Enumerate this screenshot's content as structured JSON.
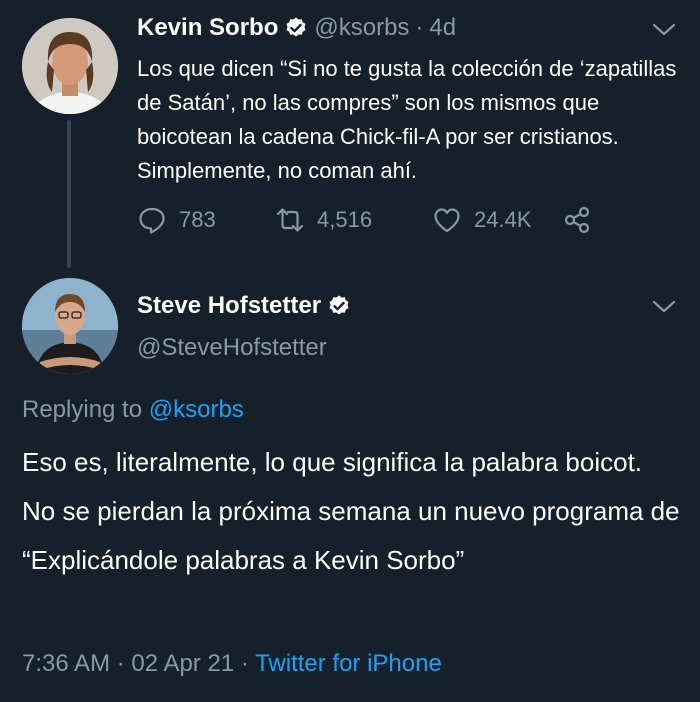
{
  "original_tweet": {
    "author_name": "Kevin Sorbo",
    "author_handle": "@ksorbs",
    "separator": "·",
    "time_ago": "4d",
    "text": "Los que dicen “Si no te gusta la colección de ‘zapatillas de Satán’, no las compres” son los mismos que boicotean la cadena Chick-fil-A por ser cristianos. Simplemente, no coman ahí.",
    "replies": "783",
    "retweets": "4,516",
    "likes": "24.4K"
  },
  "reply_tweet": {
    "author_name": "Steve Hofstetter",
    "author_handle": "@SteveHofstetter",
    "replying_prefix": "Replying to",
    "replying_to": "@ksorbs",
    "text_line1": "Eso es, literalmente, lo que significa la palabra boicot.",
    "text_line2": "No se pierdan la próxima semana un nuevo programa de “Explicándole palabras a Kevin Sorbo”",
    "time": "7:36 AM",
    "date": "02 Apr 21",
    "source": "Twitter for iPhone"
  },
  "icons": [
    "verified-badge-icon",
    "chevron-down-icon",
    "reply-icon",
    "retweet-icon",
    "like-icon",
    "share-icon"
  ],
  "colors": {
    "background": "#15202b",
    "text": "#ffffff",
    "muted": "#8899a6",
    "link": "#1da1f2",
    "thread_line": "#38444d"
  }
}
